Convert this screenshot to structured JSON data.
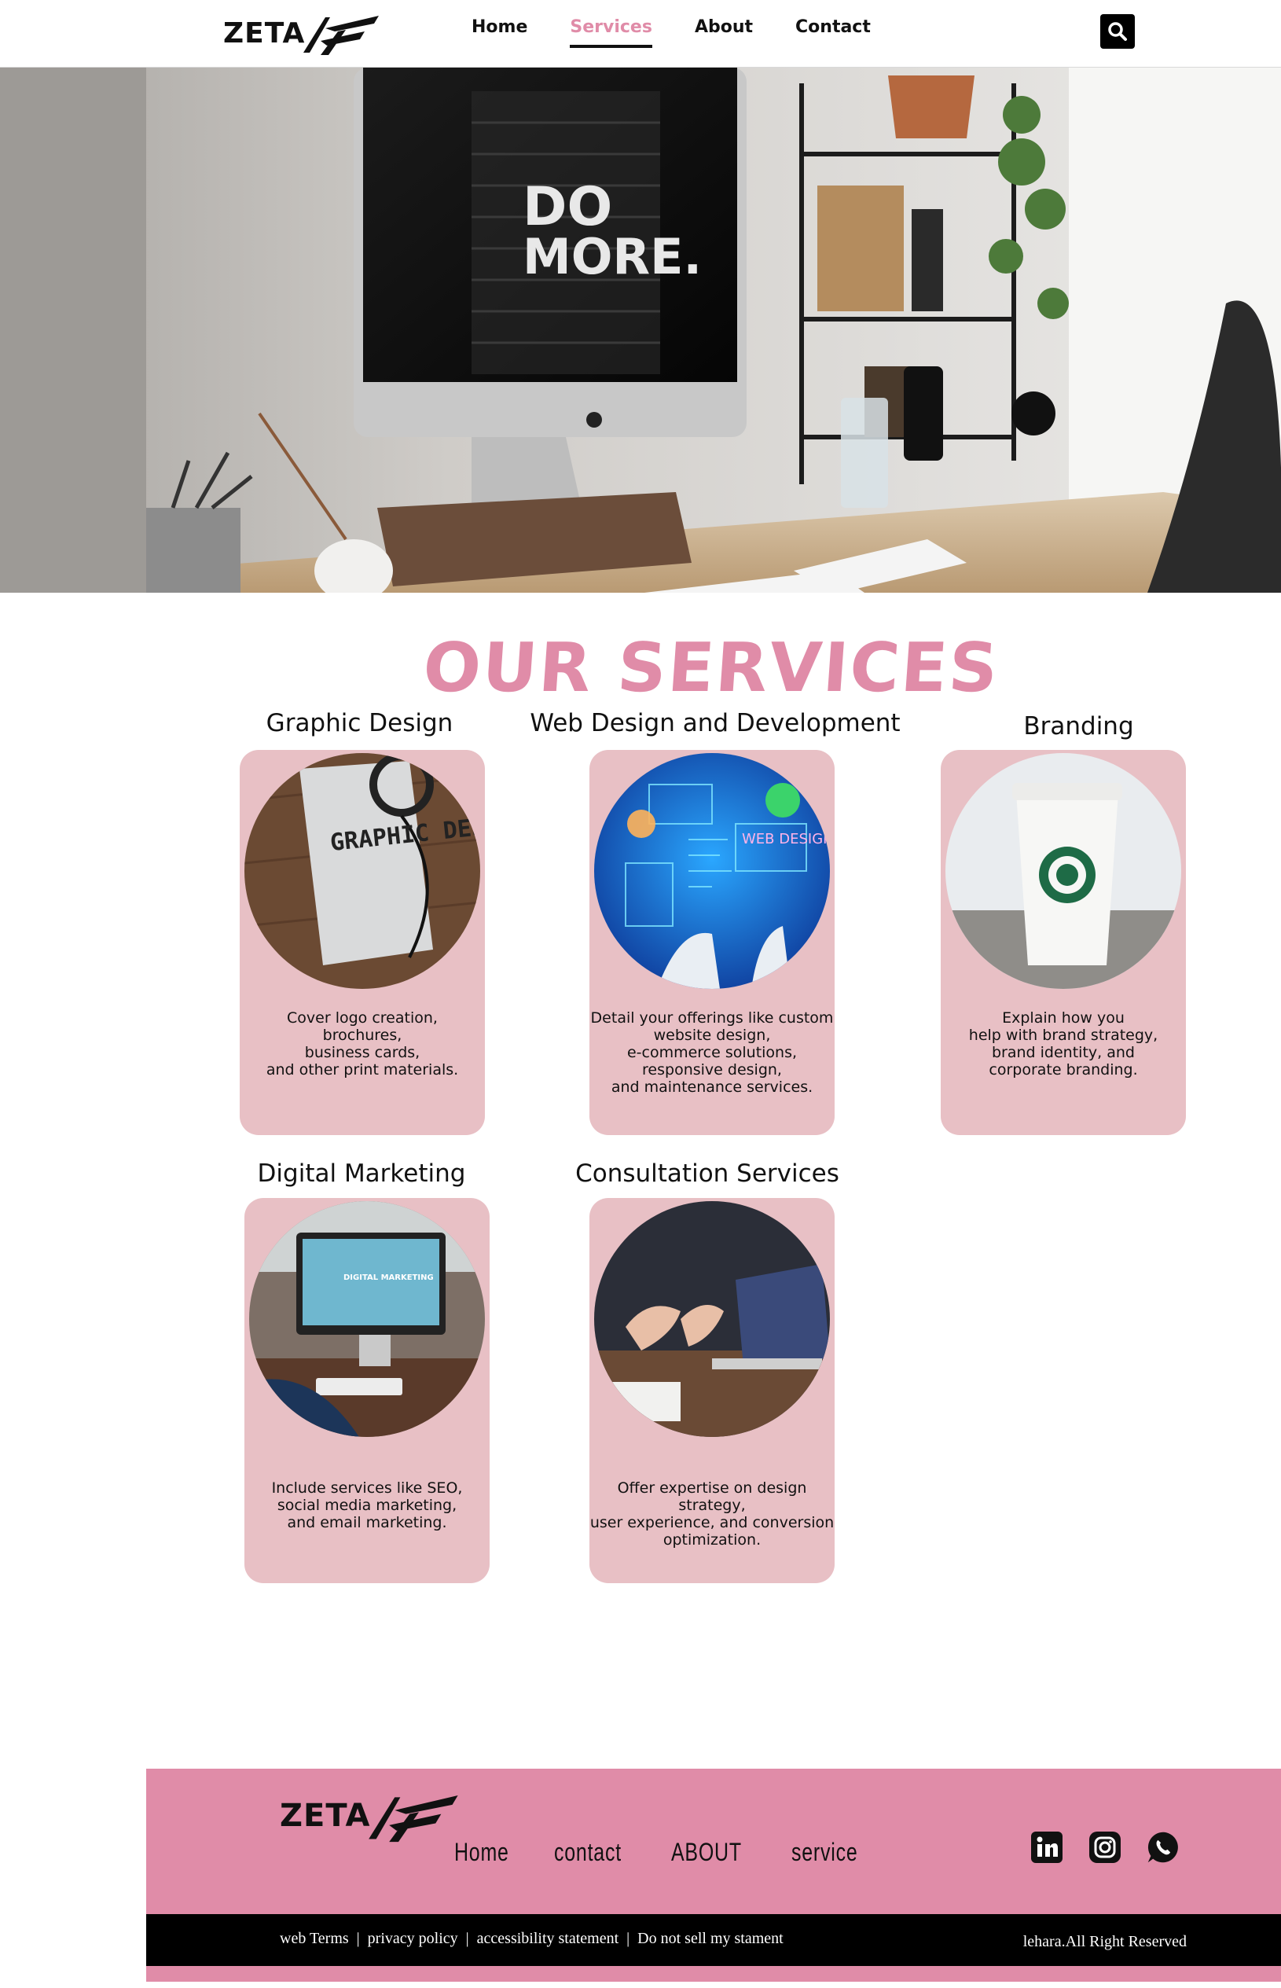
{
  "header": {
    "logo_text": "ZETA",
    "nav": [
      {
        "label": "Home",
        "active": false
      },
      {
        "label": "Services",
        "active": true
      },
      {
        "label": "About",
        "active": false
      },
      {
        "label": "Contact",
        "active": false
      }
    ],
    "search_icon": "search-icon"
  },
  "hero": {
    "screen_text_line1": "DO",
    "screen_text_line2": "MORE."
  },
  "services": {
    "heading": "OUR SERVICES",
    "items": [
      {
        "title": "Graphic Design",
        "image_text": "GRAPHIC DESIGN",
        "desc": [
          "Cover logo creation,",
          "brochures,",
          "business cards,",
          "and other print materials."
        ]
      },
      {
        "title": "Web Design and Development",
        "image_text": "WEB DESIGN",
        "desc": [
          "Detail your offerings like custom",
          "website design,",
          "e-commerce solutions,",
          "responsive design,",
          "and maintenance services."
        ]
      },
      {
        "title": "Branding",
        "image_text": "",
        "desc": [
          "Explain how you",
          "help with brand strategy,",
          "brand identity, and",
          "corporate branding."
        ]
      },
      {
        "title": "Digital Marketing",
        "image_text": "DIGITAL MARKETING",
        "desc": [
          "Include services like SEO,",
          "social media marketing,",
          "and email marketing."
        ]
      },
      {
        "title": "Consultation Services",
        "image_text": "",
        "desc": [
          "Offer expertise on design strategy,",
          "user experience, and conversion",
          "optimization."
        ]
      }
    ]
  },
  "footer": {
    "logo_text": "ZETA",
    "nav": [
      "Home",
      "contact",
      "ABOUT",
      "service"
    ],
    "socials": [
      "linkedin-icon",
      "instagram-icon",
      "whatsapp-icon"
    ],
    "legal": [
      "web Terms",
      "privacy policy",
      "accessibility statement",
      "Do not sell my stament"
    ],
    "copyright": "lehara.All Right Reserved"
  },
  "colors": {
    "accent_pink": "#e08ca8",
    "card_pink": "#e8c0c5",
    "black": "#000000"
  }
}
